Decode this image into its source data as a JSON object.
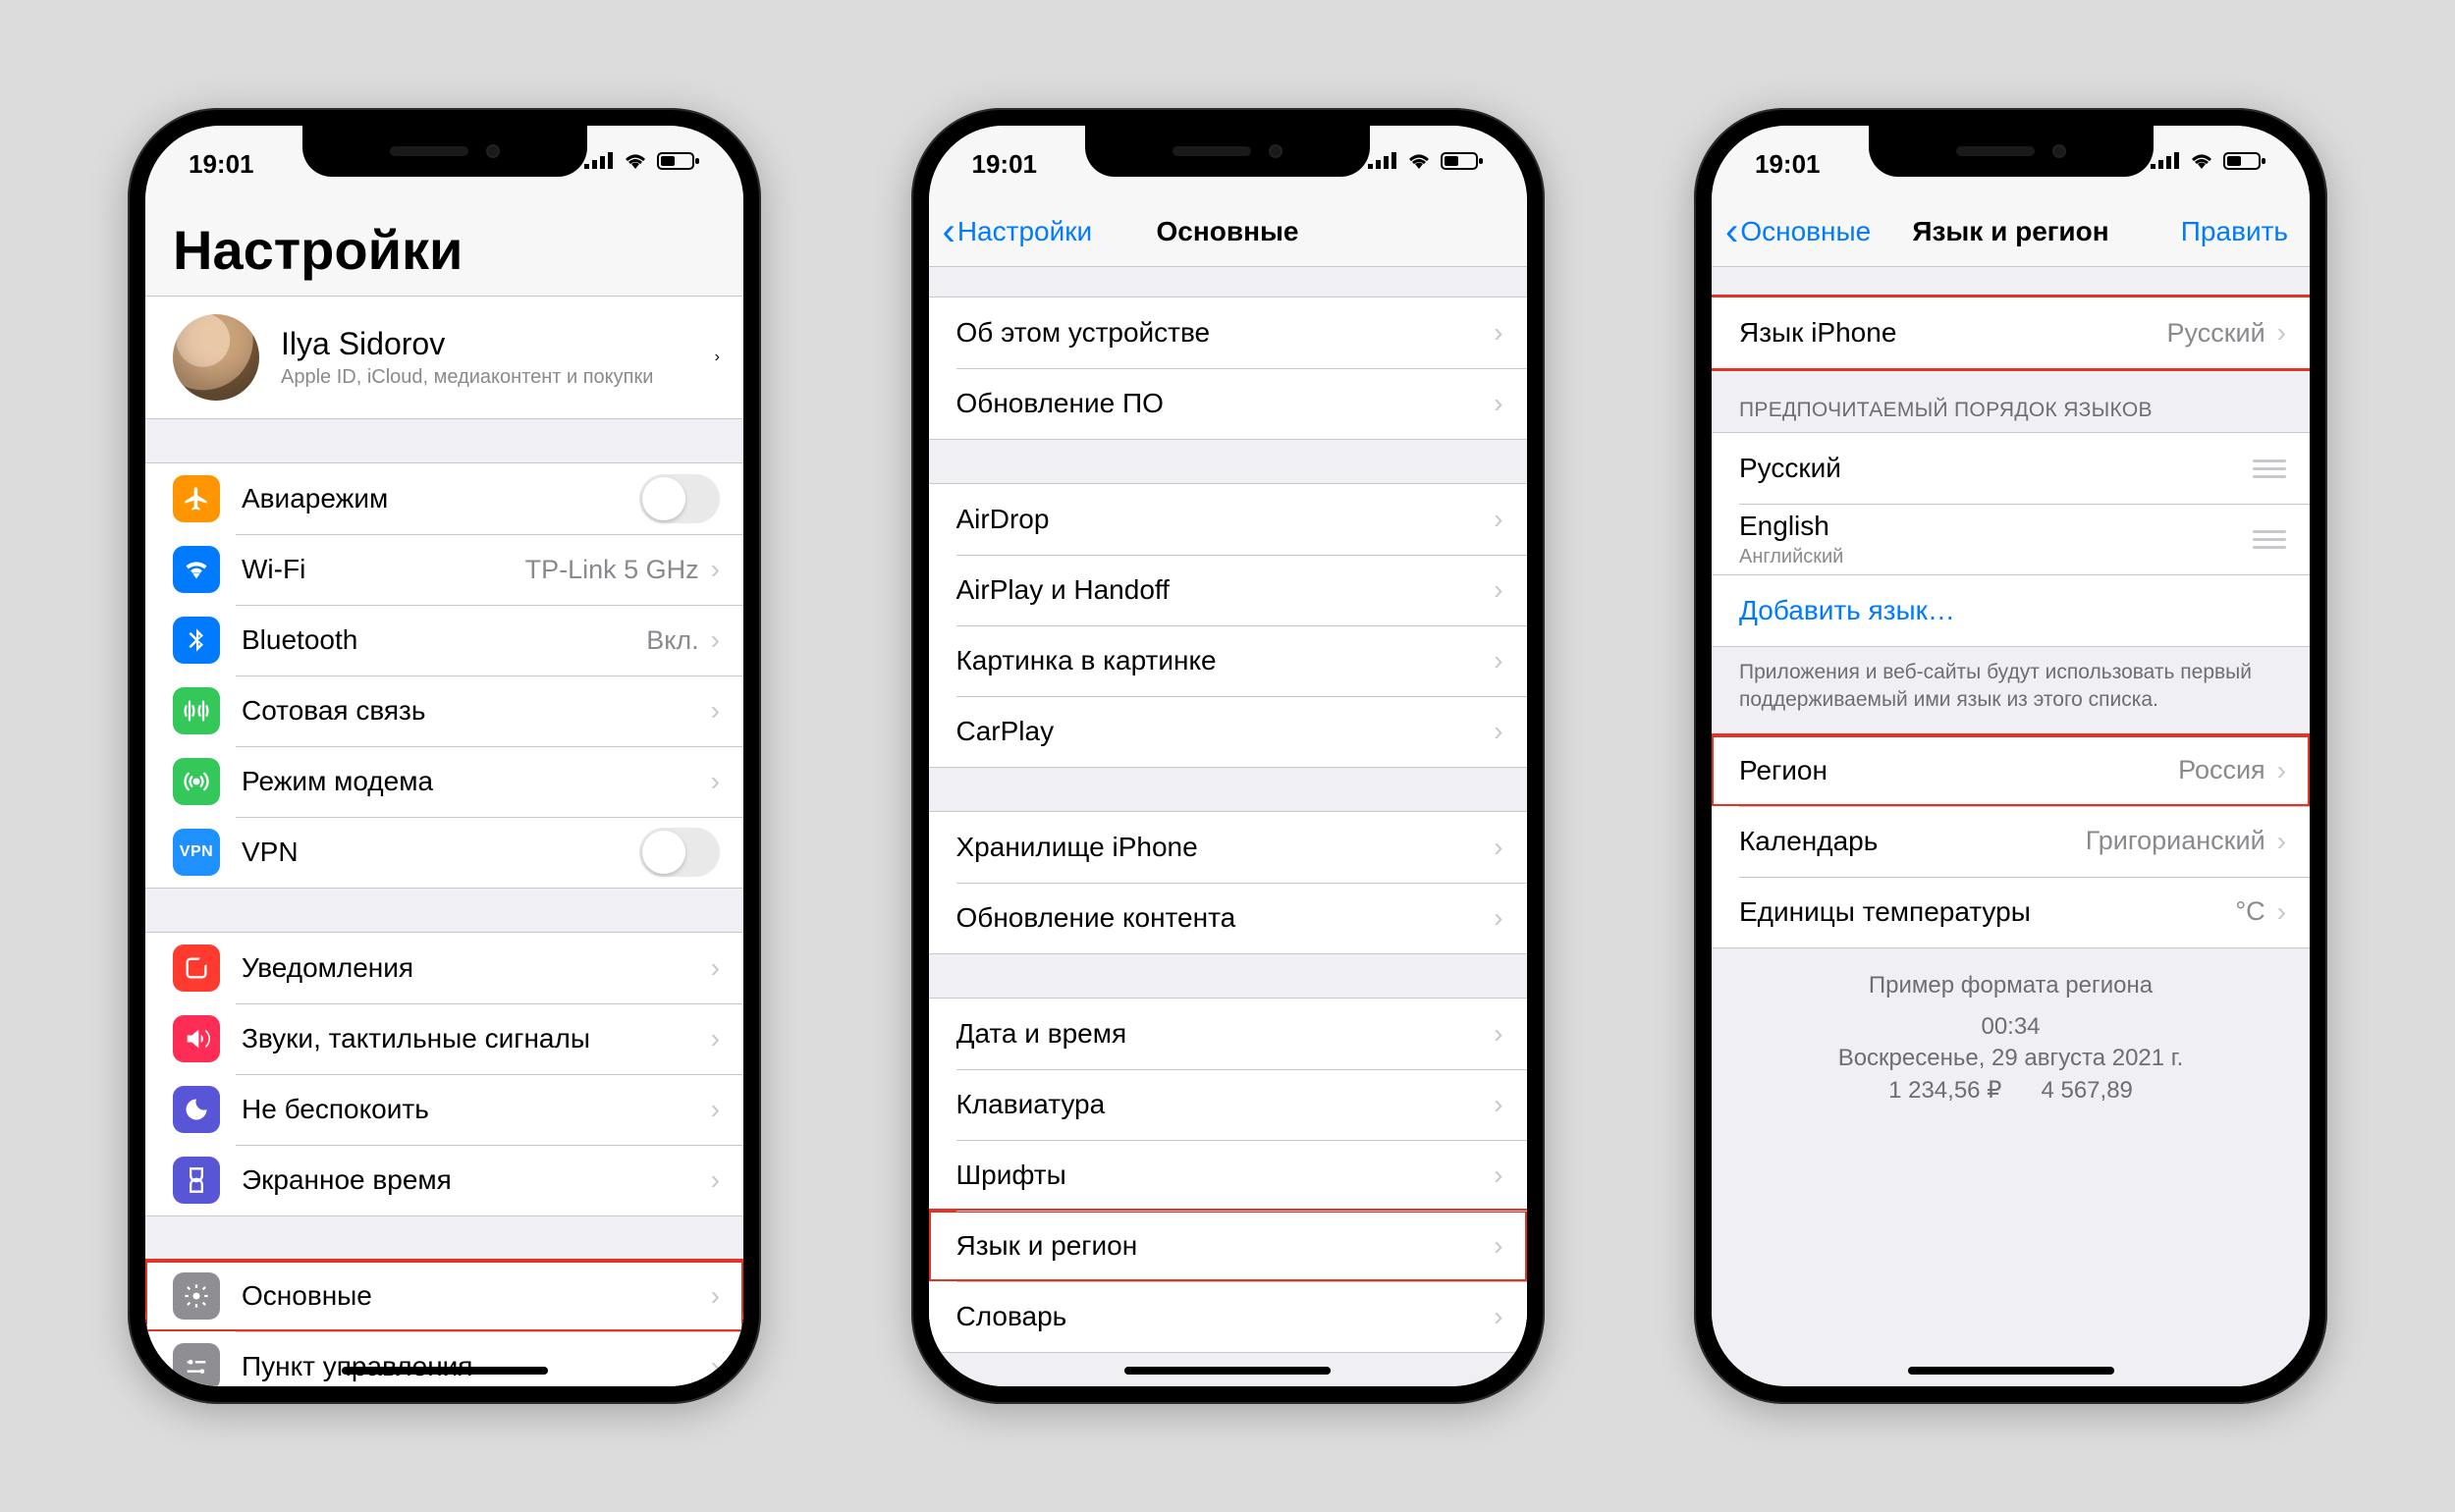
{
  "status": {
    "time": "19:01"
  },
  "phone1": {
    "title": "Настройки",
    "profile": {
      "name": "Ilya Sidorov",
      "desc": "Apple ID, iCloud, медиаконтент и покупки"
    },
    "group1": [
      {
        "key": "airplane",
        "label": "Авиарежим",
        "kind": "toggle"
      },
      {
        "key": "wifi",
        "label": "Wi-Fi",
        "value": "TP-Link 5 GHz",
        "kind": "link"
      },
      {
        "key": "bluetooth",
        "label": "Bluetooth",
        "value": "Вкл.",
        "kind": "link"
      },
      {
        "key": "cellular",
        "label": "Сотовая связь",
        "kind": "link"
      },
      {
        "key": "hotspot",
        "label": "Режим модема",
        "kind": "link"
      },
      {
        "key": "vpn",
        "label": "VPN",
        "kind": "toggle"
      }
    ],
    "group2": [
      {
        "key": "notifications",
        "label": "Уведомления"
      },
      {
        "key": "sounds",
        "label": "Звуки, тактильные сигналы"
      },
      {
        "key": "dnd",
        "label": "Не беспокоить"
      },
      {
        "key": "screentime",
        "label": "Экранное время"
      }
    ],
    "group3": [
      {
        "key": "general",
        "label": "Основные",
        "highlight": true
      },
      {
        "key": "control",
        "label": "Пункт управления"
      }
    ]
  },
  "phone2": {
    "back": "Настройки",
    "title": "Основные",
    "g1": [
      {
        "label": "Об этом устройстве"
      },
      {
        "label": "Обновление ПО"
      }
    ],
    "g2": [
      {
        "label": "AirDrop"
      },
      {
        "label": "AirPlay и Handoff"
      },
      {
        "label": "Картинка в картинке"
      },
      {
        "label": "CarPlay"
      }
    ],
    "g3": [
      {
        "label": "Хранилище iPhone"
      },
      {
        "label": "Обновление контента"
      }
    ],
    "g4": [
      {
        "label": "Дата и время"
      },
      {
        "label": "Клавиатура"
      },
      {
        "label": "Шрифты"
      },
      {
        "label": "Язык и регион",
        "highlight": true
      },
      {
        "label": "Словарь"
      }
    ]
  },
  "phone3": {
    "back": "Основные",
    "title": "Язык и регион",
    "edit": "Править",
    "iphone_lang": {
      "label": "Язык iPhone",
      "value": "Русский"
    },
    "order_header": "ПРЕДПОЧИТАЕМЫЙ ПОРЯДОК ЯЗЫКОВ",
    "langs": [
      {
        "label": "Русский"
      },
      {
        "label": "English",
        "sub": "Английский"
      }
    ],
    "add_lang": "Добавить язык…",
    "order_footer": "Приложения и веб-сайты будут использовать первый поддерживаемый ими язык из этого списка.",
    "region": {
      "label": "Регион",
      "value": "Россия"
    },
    "calendar": {
      "label": "Календарь",
      "value": "Григорианский"
    },
    "temp": {
      "label": "Единицы температуры",
      "value": "°C"
    },
    "example": {
      "header": "Пример формата региона",
      "time": "00:34",
      "date": "Воскресенье, 29 августа 2021 г.",
      "numbers": "1 234,56 ₽      4 567,89"
    }
  }
}
